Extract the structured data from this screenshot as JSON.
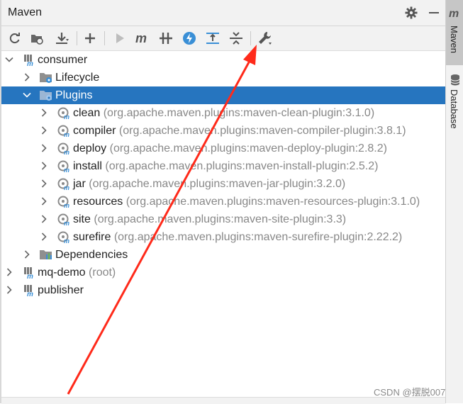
{
  "header": {
    "title": "Maven"
  },
  "side_panel": {
    "maven_tab": "Maven",
    "database_tab": "Database"
  },
  "tree": {
    "consumer": {
      "label": "consumer"
    },
    "lifecycle": {
      "label": "Lifecycle"
    },
    "plugins": {
      "label": "Plugins"
    },
    "plugin_items": [
      {
        "name": "clean",
        "coord": "(org.apache.maven.plugins:maven-clean-plugin:3.1.0)"
      },
      {
        "name": "compiler",
        "coord": "(org.apache.maven.plugins:maven-compiler-plugin:3.8.1)"
      },
      {
        "name": "deploy",
        "coord": "(org.apache.maven.plugins:maven-deploy-plugin:2.8.2)"
      },
      {
        "name": "install",
        "coord": "(org.apache.maven.plugins:maven-install-plugin:2.5.2)"
      },
      {
        "name": "jar",
        "coord": "(org.apache.maven.plugins:maven-jar-plugin:3.2.0)"
      },
      {
        "name": "resources",
        "coord": "(org.apache.maven.plugins:maven-resources-plugin:3.1.0)"
      },
      {
        "name": "site",
        "coord": "(org.apache.maven.plugins:maven-site-plugin:3.3)"
      },
      {
        "name": "surefire",
        "coord": "(org.apache.maven.plugins:maven-surefire-plugin:2.22.2)"
      }
    ],
    "dependencies": {
      "label": "Dependencies"
    },
    "mq_demo": {
      "label": "mq-demo",
      "suffix": "(root)"
    },
    "publisher": {
      "label": "publisher"
    }
  },
  "watermark": "CSDN @摆脱007",
  "colors": {
    "selection": "#2675bf",
    "arrow": "#ff2a1a",
    "icon_blue": "#3a8fd6"
  }
}
